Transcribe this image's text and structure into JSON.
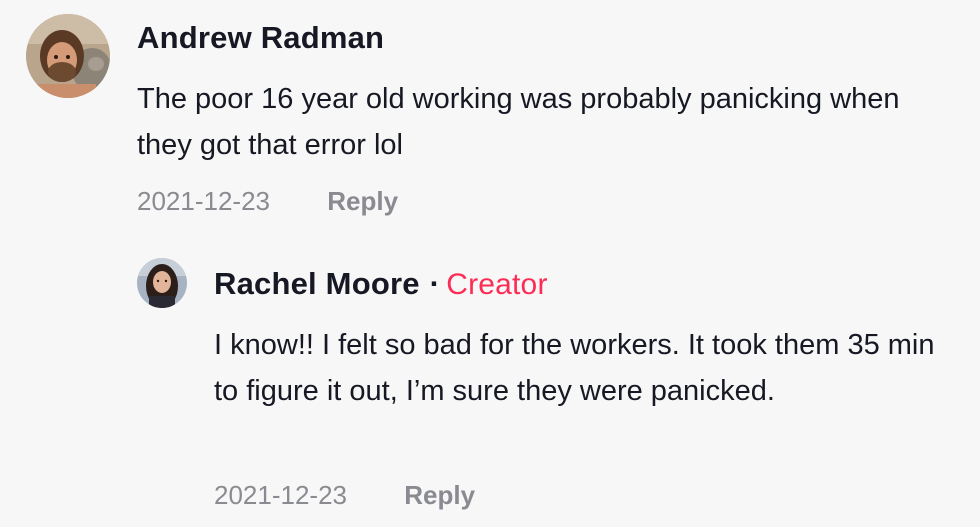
{
  "comments": [
    {
      "author": "Andrew Radman",
      "avatar_icon": "user-avatar-bearded-man-with-cat",
      "text": "The poor 16 year old working was probably panicking when they got that error lol",
      "date": "2021-12-23",
      "reply_label": "Reply"
    },
    {
      "author": "Rachel Moore",
      "separator": "·",
      "badge": "Creator",
      "badge_color": "#fe2c55",
      "avatar_icon": "user-avatar-woman-long-hair",
      "text": "I know!! I felt so bad for the workers. It took them 35 min to figure it out, I’m sure they were panicked.",
      "date": "2021-12-23",
      "reply_label": "Reply"
    }
  ]
}
